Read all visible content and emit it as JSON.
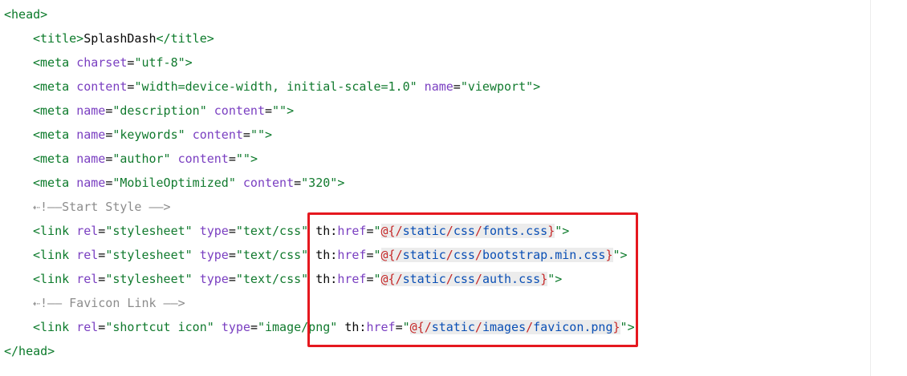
{
  "code": {
    "head_open": "<head>",
    "title_open": "<title>",
    "title_text": "SplashDash",
    "title_close": "</title>",
    "meta1": {
      "tag": "<meta",
      "attr": "charset",
      "eq": "=",
      "val": "\"utf-8\"",
      "end": ">"
    },
    "meta2": {
      "tag": "<meta",
      "attr1": "content",
      "val1": "\"width=device-width, initial-scale=1.0\"",
      "attr2": "name",
      "val2": "\"viewport\"",
      "end": ">"
    },
    "meta3": {
      "tag": "<meta",
      "attr1": "name",
      "val1": "\"description\"",
      "attr2": "content",
      "val2": "\"\"",
      "end": ">"
    },
    "meta4": {
      "tag": "<meta",
      "attr1": "name",
      "val1": "\"keywords\"",
      "attr2": "content",
      "val2": "\"\"",
      "end": ">"
    },
    "meta5": {
      "tag": "<meta",
      "attr1": "name",
      "val1": "\"author\"",
      "attr2": "content",
      "val2": "\"\"",
      "end": ">"
    },
    "meta6": {
      "tag": "<meta",
      "attr1": "name",
      "val1": "\"MobileOptimized\"",
      "attr2": "content",
      "val2": "\"320\"",
      "end": ">"
    },
    "comment_style": "⇠!——Start Style ——>",
    "link1": {
      "tag": "<link",
      "rel_attr": "rel",
      "rel_val": "\"stylesheet\"",
      "type_attr": "type",
      "type_val": "\"text/css\"",
      "ns": "th",
      "href": "href",
      "open_q": "\"",
      "at": "@{",
      "s1": "/",
      "p1": "static",
      "s2": "/",
      "p2": "css",
      "s3": "/",
      "file": "fonts.css",
      "close": "}",
      "close_q": "\"",
      "end": ">"
    },
    "link2": {
      "tag": "<link",
      "rel_attr": "rel",
      "rel_val": "\"stylesheet\"",
      "type_attr": "type",
      "type_val": "\"text/css\"",
      "ns": "th",
      "href": "href",
      "open_q": "\"",
      "at": "@{",
      "s1": "/",
      "p1": "static",
      "s2": "/",
      "p2": "css",
      "s3": "/",
      "file": "bootstrap.min.css",
      "close": "}",
      "close_q": "\"",
      "end": ">"
    },
    "link3": {
      "tag": "<link",
      "rel_attr": "rel",
      "rel_val": "\"stylesheet\"",
      "type_attr": "type",
      "type_val": "\"text/css\"",
      "ns": "th",
      "href": "href",
      "open_q": "\"",
      "at": "@{",
      "s1": "/",
      "p1": "static",
      "s2": "/",
      "p2": "css",
      "s3": "/",
      "file": "auth.css",
      "close": "}",
      "close_q": "\"",
      "end": ">"
    },
    "comment_favicon": "⇠!—— Favicon Link ——>",
    "link4": {
      "tag": "<link",
      "rel_attr": "rel",
      "rel_val": "\"shortcut icon\"",
      "type_attr": "type",
      "type_val": "\"image/png\"",
      "ns": "th",
      "href": "href",
      "open_q": "\"",
      "at": "@{",
      "s1": "/",
      "p1": "static",
      "s2": "/",
      "p2": "images",
      "s3": "/",
      "file": "favicon.png",
      "close": "}",
      "close_q": "\"",
      "end": ">"
    },
    "head_close": "</head>"
  },
  "colors": {
    "tag": "#0b7a2a",
    "attribute": "#7a3fc1",
    "string": "#117a2e",
    "comment": "#8c8c8c",
    "url_path": "#0a4fb5",
    "url_symbol": "#c62828",
    "highlight_border": "#e5181f"
  }
}
